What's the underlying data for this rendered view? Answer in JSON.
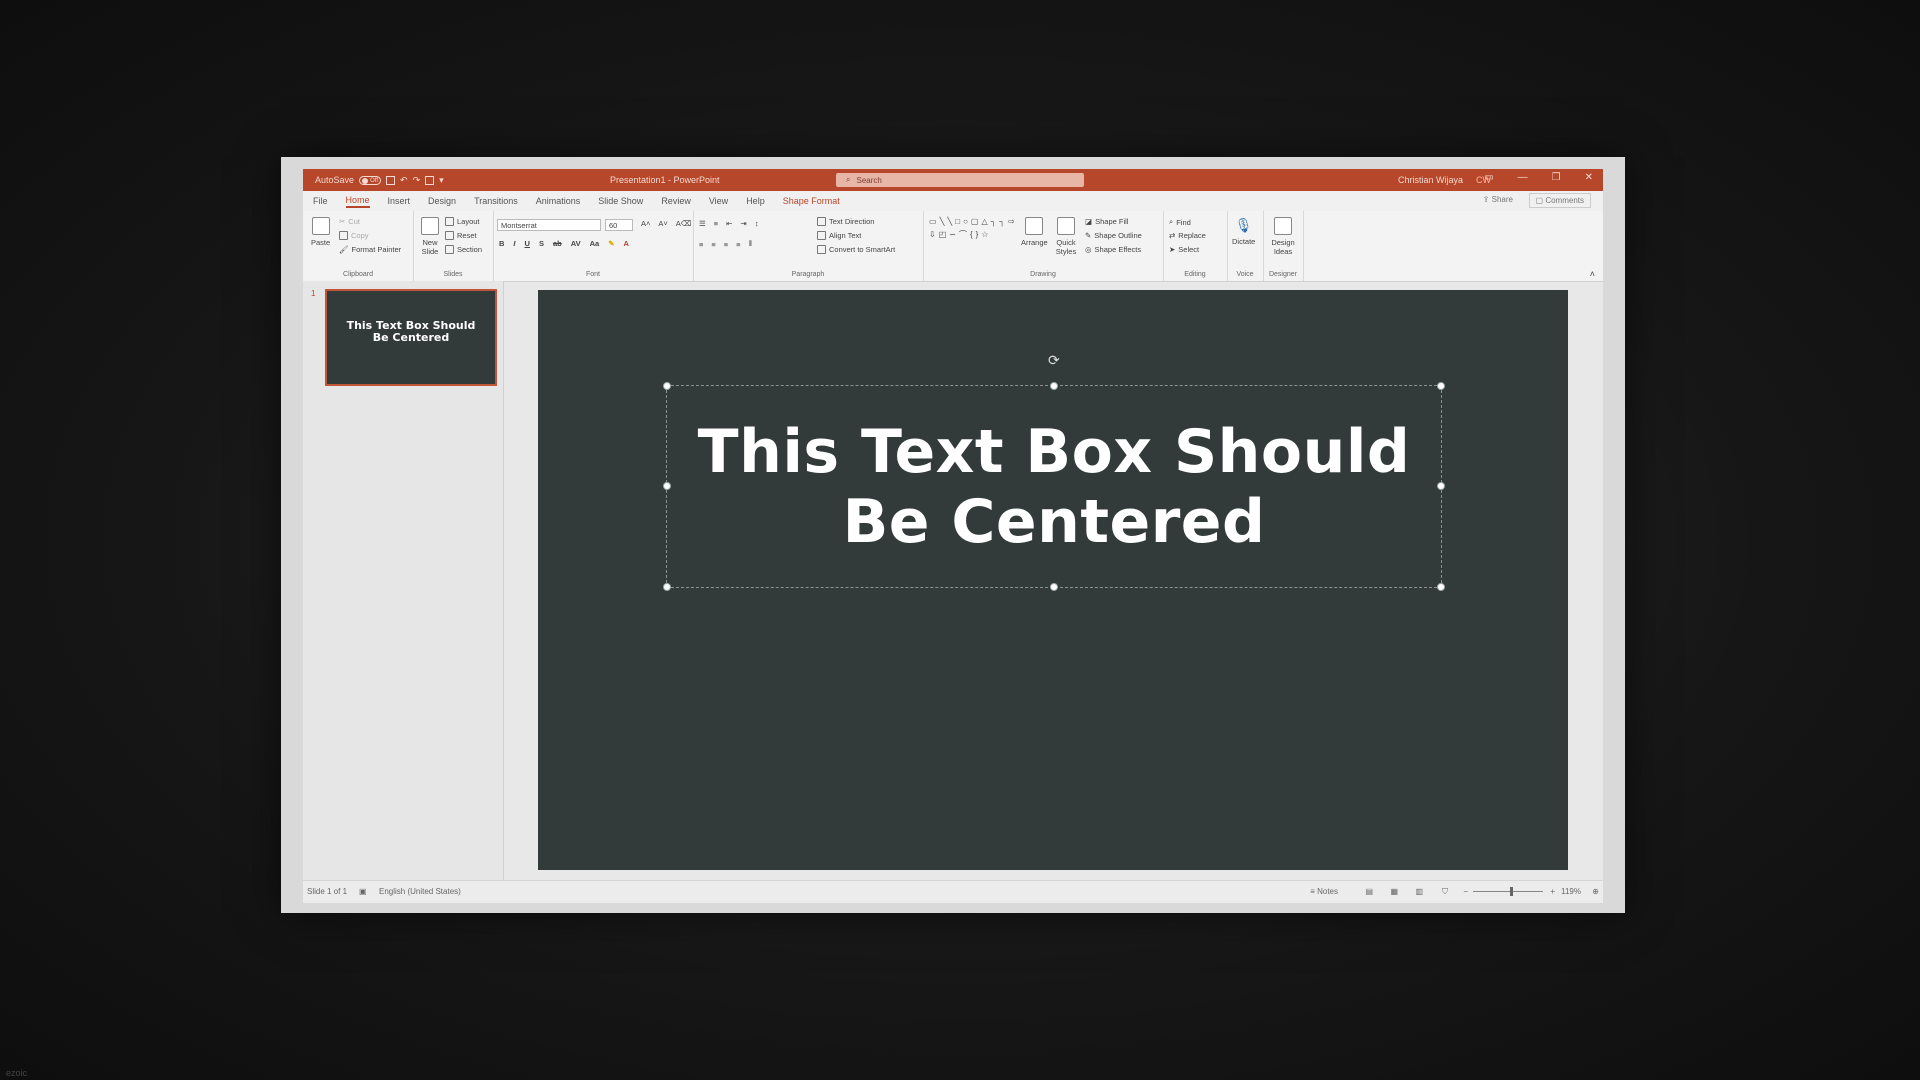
{
  "titlebar": {
    "autosave_label": "AutoSave",
    "autosave_state": "Off",
    "doc_title": "Presentation1 - PowerPoint",
    "search_placeholder": "Search",
    "user_name": "Christian Wijaya",
    "user_initials": "CW",
    "accent_color": "#b7472a"
  },
  "tabs": [
    "File",
    "Home",
    "Insert",
    "Design",
    "Transitions",
    "Animations",
    "Slide Show",
    "Review",
    "View",
    "Help",
    "Shape Format"
  ],
  "active_tab": "Home",
  "share_label": "Share",
  "comments_label": "Comments",
  "ribbon": {
    "clipboard": {
      "paste": "Paste",
      "cut": "Cut",
      "copy": "Copy",
      "format_painter": "Format Painter",
      "group": "Clipboard"
    },
    "slides": {
      "new_slide": "New Slide",
      "layout": "Layout",
      "reset": "Reset",
      "section": "Section",
      "group": "Slides"
    },
    "font": {
      "name": "Montserrat",
      "size": "60",
      "group": "Font"
    },
    "paragraph": {
      "text_direction": "Text Direction",
      "align_text": "Align Text",
      "convert_smartart": "Convert to SmartArt",
      "group": "Paragraph"
    },
    "drawing": {
      "arrange": "Arrange",
      "quick_styles": "Quick Styles",
      "shape_fill": "Shape Fill",
      "shape_outline": "Shape Outline",
      "shape_effects": "Shape Effects",
      "group": "Drawing"
    },
    "editing": {
      "find": "Find",
      "replace": "Replace",
      "select": "Select",
      "group": "Editing"
    },
    "voice": {
      "dictate": "Dictate",
      "group": "Voice"
    },
    "designer": {
      "design_ideas": "Design Ideas",
      "group": "Designer"
    }
  },
  "thumbnail": {
    "number": "1",
    "text": "This Text Box Should Be Centered"
  },
  "slide": {
    "text_line1": "This Text Box Should",
    "text_line2": "Be Centered",
    "background": "#333a3a"
  },
  "status": {
    "slide_info": "Slide 1 of 1",
    "language": "English (United States)",
    "notes": "Notes",
    "zoom": "119%"
  },
  "watermark": "ezoic"
}
